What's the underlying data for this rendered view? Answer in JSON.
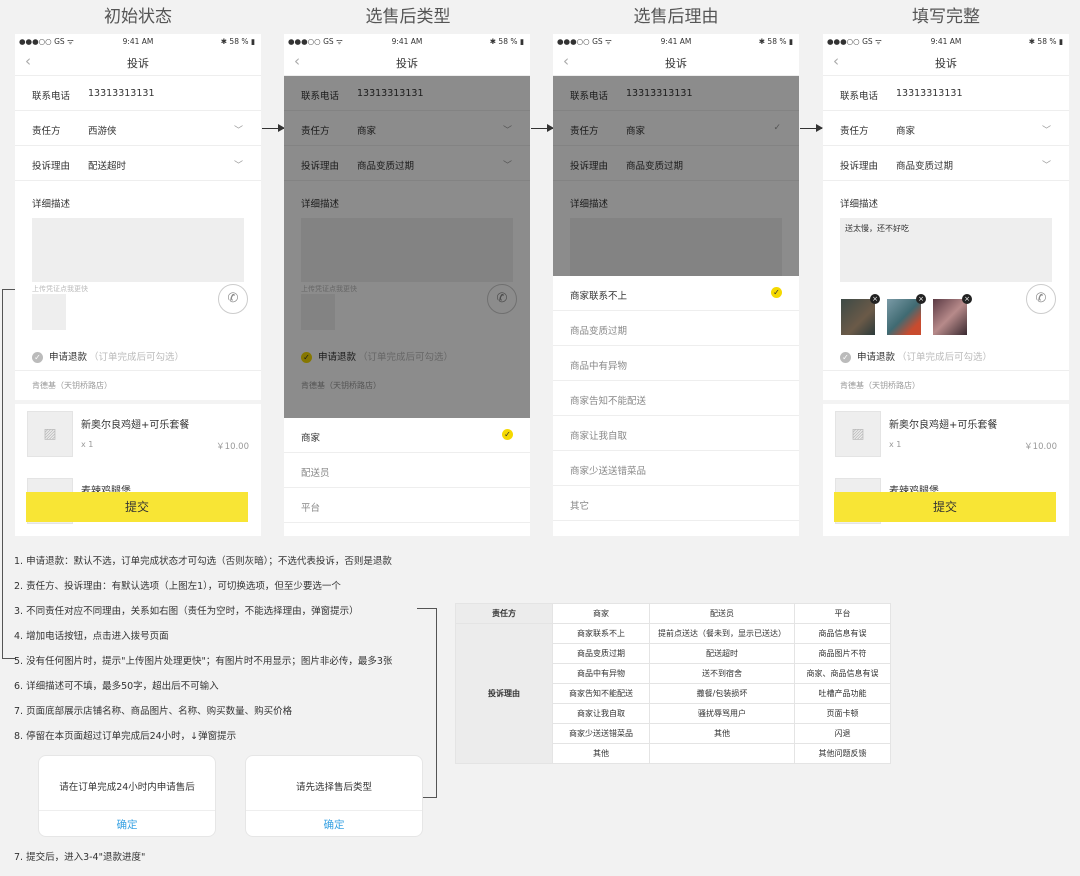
{
  "stages": [
    "初始状态",
    "选售后类型",
    "选售后理由",
    "填写完整"
  ],
  "status": {
    "left": "●●●○○ GS ᯤ",
    "time": "9:41 AM",
    "right": "✱ 58 % ▮"
  },
  "page_title": "投诉",
  "back_icon": "‹",
  "fields": {
    "phone_label": "联系电话",
    "phone_value": "13313313131",
    "party_label": "责任方",
    "party_initial": "西游侠",
    "party_selected": "商家",
    "reason_label": "投诉理由",
    "reason_initial": "配送超时",
    "reason_selected": "商品变质过期",
    "detail_label": "详细描述",
    "detail_text": "送太慢，还不好吃",
    "upload_hint": "上传凭证点我更快",
    "refund_label": "申请退款",
    "refund_note": "（订单完成后可勾选）",
    "shop_name": "肯德基（天钥桥路店）",
    "goods": [
      {
        "name": "新奥尔良鸡翅+可乐套餐",
        "qty": "x 1",
        "price": "￥10.00"
      },
      {
        "name": "麦辣鸡腿堡"
      }
    ],
    "submit": "提交"
  },
  "type_options": [
    "商家",
    "配送员",
    "平台"
  ],
  "reason_options": [
    "商家联系不上",
    "商品变质过期",
    "商品中有异物",
    "商家告知不能配送",
    "商家让我自取",
    "商家少送送错菜品",
    "其它"
  ],
  "notes": [
    "1. 申请退款：默认不选，订单完成状态才可勾选（否则灰暗）；不选代表投诉，否则是退款",
    "2. 责任方、投诉理由：有默认选项（上图左1），可切换选项，但至少要选一个",
    "3. 不同责任对应不同理由，关系如右图（责任为空时，不能选择理由，弹窗提示）",
    "4. 增加电话按钮，点击进入拨号页面",
    "5. 没有任何图片时，提示\"上传图片处理更快\"；有图片时不用显示；图片非必传，最多3张",
    "6. 详细描述可不填，最多50字，超出后不可输入",
    "7. 页面底部展示店铺名称、商品图片、名称、购买数量、购买价格",
    "8. 停留在本页面超过订单完成后24小时，↓弹窗提示"
  ],
  "note_final": "7. 提交后，进入3-4\"退款进度\"",
  "dialogs": [
    {
      "msg": "请在订单完成24小时内申请售后",
      "ok": "确定"
    },
    {
      "msg": "请先选择售后类型",
      "ok": "确定"
    }
  ],
  "table": {
    "party_header": "责任方",
    "reason_header": "投诉理由",
    "cols": [
      "商家",
      "配送员",
      "平台"
    ],
    "rows": [
      [
        "商家联系不上",
        "提前点送达（餐未到，显示已送达）",
        "商品信息有误"
      ],
      [
        "商品变质过期",
        "配送超时",
        "商品图片不符"
      ],
      [
        "商品中有异物",
        "送不到宿舍",
        "商家、商品信息有误"
      ],
      [
        "商家告知不能配送",
        "撒餐/包装损坏",
        "吐槽产品功能"
      ],
      [
        "商家让我自取",
        "骚扰辱骂用户",
        "页面卡顿"
      ],
      [
        "商家少送送错菜品",
        "其他",
        "闪退"
      ],
      [
        "其他",
        "",
        "其他问题反馈"
      ]
    ]
  },
  "icons": {
    "chevron": "﹀",
    "check": "✓",
    "phone": "✆",
    "image": "▨",
    "close": "×"
  }
}
